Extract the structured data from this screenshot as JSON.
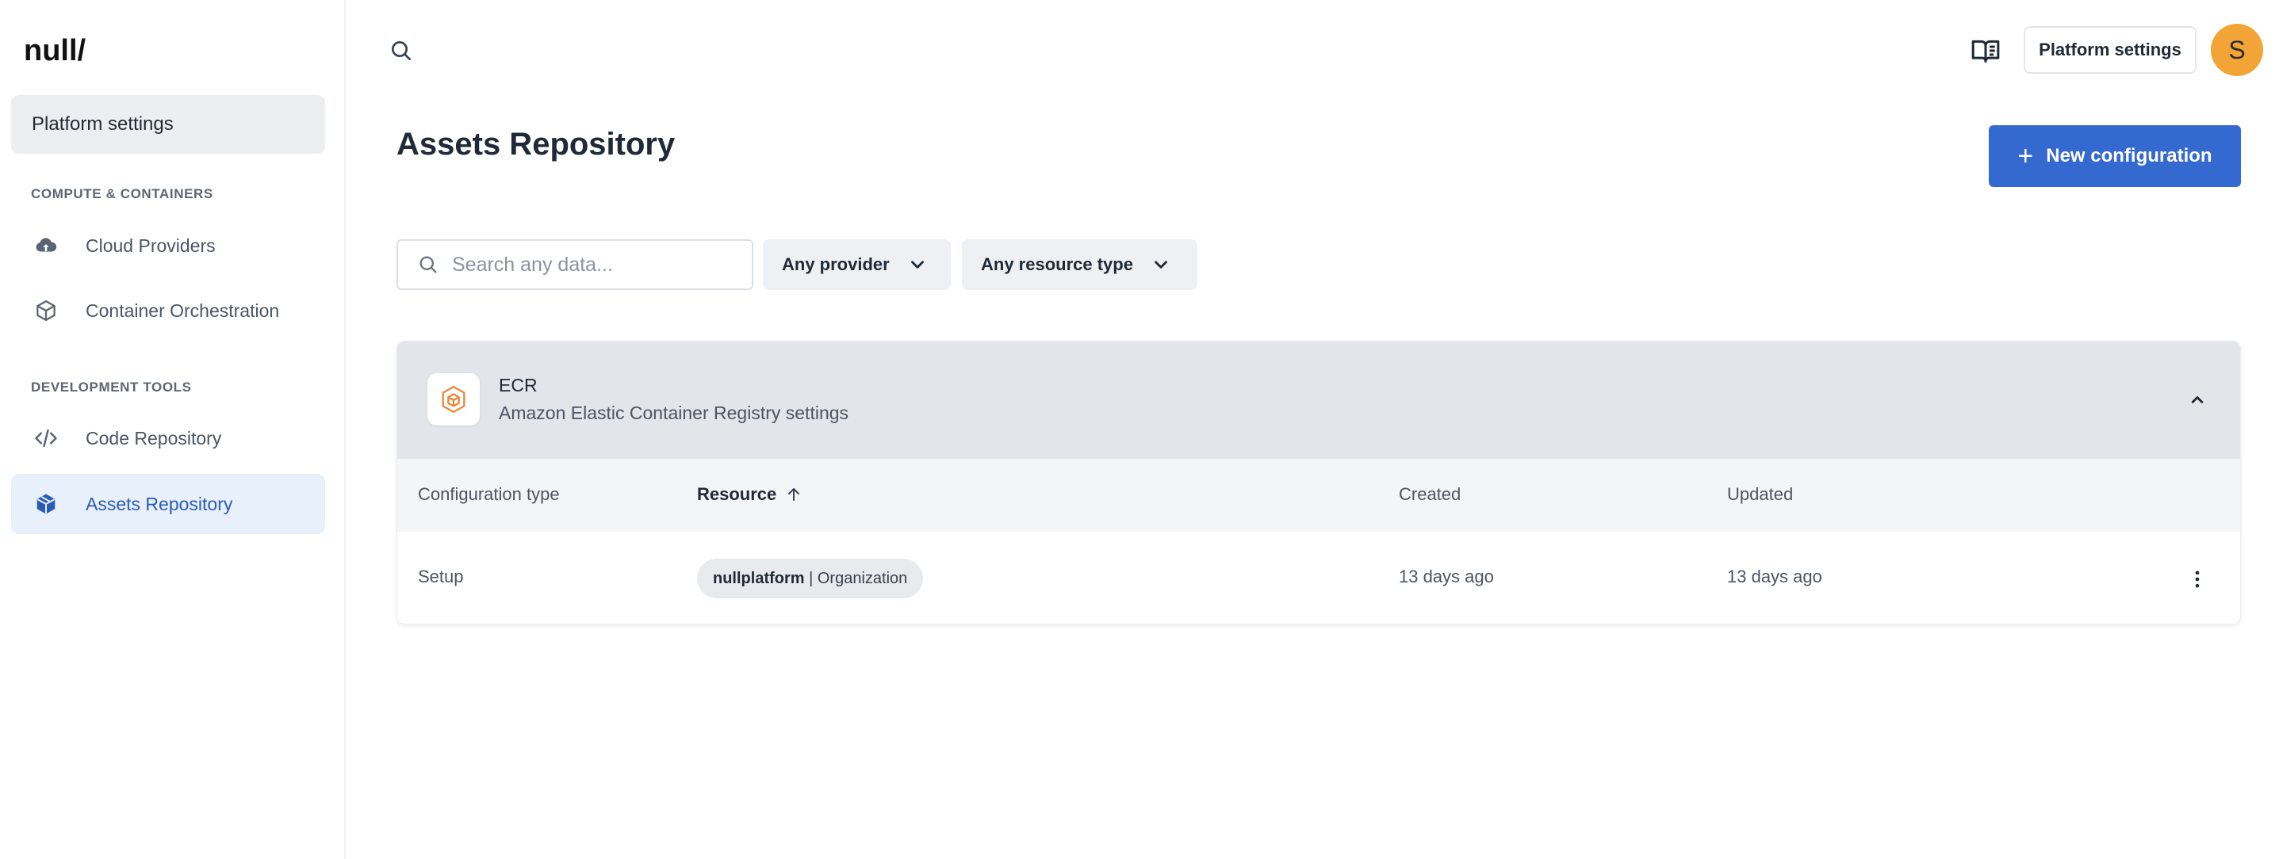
{
  "brand": {
    "logo_text": "null/"
  },
  "sidebar": {
    "top_item": "Platform settings",
    "sections": [
      {
        "title": "COMPUTE & CONTAINERS",
        "items": [
          {
            "label": "Cloud Providers",
            "icon": "cloud-upload-icon"
          },
          {
            "label": "Container Orchestration",
            "icon": "cube-icon"
          }
        ]
      },
      {
        "title": "DEVELOPMENT TOOLS",
        "items": [
          {
            "label": "Code Repository",
            "icon": "code-icon"
          },
          {
            "label": "Assets Repository",
            "icon": "package-icon",
            "active": true
          }
        ]
      }
    ]
  },
  "header": {
    "platform_settings_label": "Platform settings",
    "avatar_initial": "S"
  },
  "main": {
    "title": "Assets Repository",
    "new_button": "New configuration",
    "search_placeholder": "Search any data...",
    "filters": {
      "provider": "Any provider",
      "resource_type": "Any resource type"
    }
  },
  "card": {
    "name": "ECR",
    "description": "Amazon Elastic Container Registry settings",
    "columns": [
      "Configuration type",
      "Resource",
      "Created",
      "Updated"
    ],
    "rows": [
      {
        "configuration_type": "Setup",
        "resource_bold": "nullplatform",
        "resource_rest": " | Organization",
        "created": "13 days ago",
        "updated": "13 days ago"
      }
    ]
  },
  "colors": {
    "accent": "#3469d0",
    "active_bg": "#e7f0fb",
    "avatar": "#f2a536",
    "ecr_orange": "#e8893a"
  }
}
